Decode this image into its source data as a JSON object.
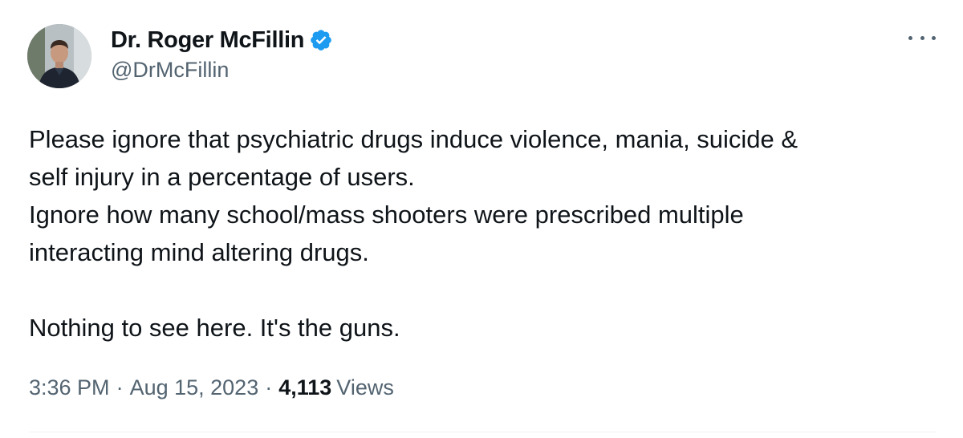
{
  "author": {
    "display_name": "Dr. Roger McFillin",
    "handle": "@DrMcFillin",
    "verified": true,
    "verified_color": "#1d9bf0"
  },
  "tweet": {
    "lines": [
      "Please ignore that psychiatric drugs induce violence, mania, suicide &",
      "self injury in a percentage of users.",
      "Ignore how many school/mass shooters were prescribed multiple",
      "interacting mind altering drugs.",
      "",
      "Nothing to see here. It's the guns."
    ]
  },
  "meta": {
    "time": "3:36 PM",
    "separator": "·",
    "date": "Aug 15, 2023",
    "views_count": "4,113",
    "views_label": "Views"
  },
  "icons": {
    "more": "more-options-icon",
    "verified": "verified-badge-icon"
  }
}
